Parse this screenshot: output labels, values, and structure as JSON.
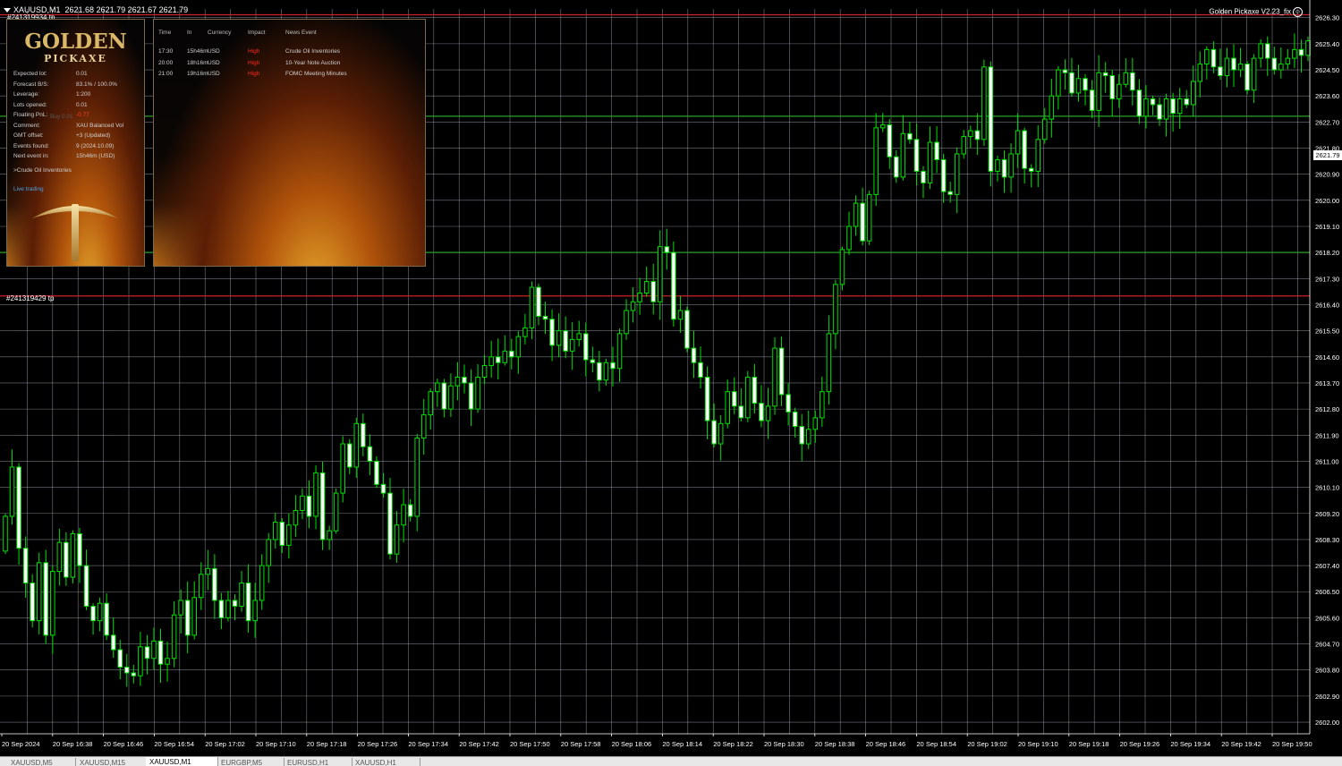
{
  "window": {
    "symbol_info": "XAUUSD,M1",
    "ohlc": "2621.68 2621.79 2621.67 2621.79",
    "ea_label": "Golden Pickaxe V2.23_fix",
    "current_price": "2621.79"
  },
  "trade_labels": {
    "top": "#241319934 tp",
    "middle": "#241319429 tp"
  },
  "panel": {
    "logo_top": "GOLDEN",
    "logo_bottom": "PICKAXE",
    "rows": [
      {
        "key": "Expected lot:",
        "value": "0.01"
      },
      {
        "key": "Forecast B/S:",
        "value": "83.1% / 100.0%"
      },
      {
        "key": "Leverage:",
        "value": "1:200"
      },
      {
        "key": "Lots opened:",
        "value": "0.01"
      },
      {
        "key": "Floating PnL:",
        "value": "-0.77"
      },
      {
        "key": "Comment:",
        "value": "XAU Balanced Vol"
      },
      {
        "key": "GMT offset:",
        "value": "+3 (Updated)"
      },
      {
        "key": "Events found:",
        "value": "9 (2024.10.09)"
      },
      {
        "key": "Next event in:",
        "value": "15h46m (USD)"
      }
    ],
    "buy_ghost": "Buy 0.01",
    "next_news": ">Crude Oil Inventories",
    "live_trading": "Live trading"
  },
  "news": {
    "headers": [
      "Time",
      "In",
      "Currency",
      "Impact",
      "News Event"
    ],
    "rows": [
      {
        "time": "17:30",
        "in": "15h46m",
        "currency": "USD",
        "impact": "High",
        "event": "Crude Oil Inventories"
      },
      {
        "time": "20:00",
        "in": "18h16m",
        "currency": "USD",
        "impact": "High",
        "event": "10-Year Note Auction"
      },
      {
        "time": "21:00",
        "in": "19h16m",
        "currency": "USD",
        "impact": "High",
        "event": "FOMC Meeting Minutes"
      }
    ]
  },
  "tabs": [
    {
      "label": "XAUUSD,M5",
      "active": false
    },
    {
      "label": "XAUUSD,M15",
      "active": false
    },
    {
      "label": "XAUUSD,M1",
      "active": true
    },
    {
      "label": "EURGBP,M5",
      "active": false
    },
    {
      "label": "EURUSD,H1",
      "active": false
    },
    {
      "label": "XAUUSD,H1",
      "active": false
    }
  ],
  "chart_data": {
    "type": "candlestick",
    "symbol": "XAUUSD",
    "timeframe": "M1",
    "ylim": [
      2601.6,
      2626.6
    ],
    "y_ticks": [
      "2626.30",
      "2625.40",
      "2624.50",
      "2623.60",
      "2622.70",
      "2621.80",
      "2620.90",
      "2620.00",
      "2619.10",
      "2618.20",
      "2617.30",
      "2616.40",
      "2615.50",
      "2614.60",
      "2613.70",
      "2612.80",
      "2611.90",
      "2611.00",
      "2610.10",
      "2609.20",
      "2608.30",
      "2607.40",
      "2606.50",
      "2605.60",
      "2604.70",
      "2603.80",
      "2602.90",
      "2602.00"
    ],
    "x_ticks": [
      "20 Sep 2024",
      "20 Sep 16:38",
      "20 Sep 16:46",
      "20 Sep 16:54",
      "20 Sep 17:02",
      "20 Sep 17:10",
      "20 Sep 17:18",
      "20 Sep 17:26",
      "20 Sep 17:34",
      "20 Sep 17:42",
      "20 Sep 17:50",
      "20 Sep 17:58",
      "20 Sep 18:06",
      "20 Sep 18:14",
      "20 Sep 18:22",
      "20 Sep 18:30",
      "20 Sep 18:38",
      "20 Sep 18:46",
      "20 Sep 18:54",
      "20 Sep 19:02",
      "20 Sep 19:10",
      "20 Sep 19:18",
      "20 Sep 19:26",
      "20 Sep 19:34",
      "20 Sep 19:42",
      "20 Sep 19:50"
    ],
    "levels": [
      {
        "price": 2626.4,
        "color": "#d0202a"
      },
      {
        "price": 2622.9,
        "color": "#2aa02a"
      },
      {
        "price": 2618.2,
        "color": "#2aa02a"
      },
      {
        "price": 2616.7,
        "color": "#d0202a"
      }
    ],
    "colors": {
      "bull": "#000000",
      "bear": "#ffffff",
      "outline": "#00e000",
      "grid": "#cfd8e8"
    },
    "closes": [
      2609.1,
      2610.8,
      2608.0,
      2606.8,
      2605.5,
      2607.5,
      2605.0,
      2607.2,
      2608.2,
      2607.0,
      2608.5,
      2607.4,
      2606.0,
      2605.5,
      2606.1,
      2605.0,
      2604.5,
      2603.9,
      2603.7,
      2603.6,
      2604.6,
      2604.2,
      2604.8,
      2604.0,
      2604.2,
      2605.7,
      2606.2,
      2605.0,
      2606.3,
      2607.1,
      2607.3,
      2606.2,
      2605.6,
      2606.2,
      2606.0,
      2606.8,
      2605.5,
      2606.2,
      2607.4,
      2608.3,
      2608.9,
      2608.1,
      2608.8,
      2609.3,
      2609.8,
      2609.1,
      2610.6,
      2608.3,
      2608.6,
      2609.9,
      2611.6,
      2610.8,
      2612.3,
      2611.5,
      2611.0,
      2610.2,
      2609.9,
      2607.8,
      2608.8,
      2609.5,
      2609.1,
      2611.8,
      2612.6,
      2613.4,
      2613.7,
      2612.8,
      2613.6,
      2613.9,
      2613.7,
      2612.8,
      2613.9,
      2614.3,
      2614.6,
      2614.4,
      2614.8,
      2614.6,
      2615.3,
      2615.6,
      2617.0,
      2616.0,
      2615.9,
      2615.0,
      2615.5,
      2614.8,
      2615.2,
      2615.4,
      2614.5,
      2614.4,
      2613.8,
      2614.4,
      2614.2,
      2615.4,
      2616.2,
      2616.5,
      2616.8,
      2617.2,
      2616.5,
      2618.4,
      2618.2,
      2615.9,
      2616.2,
      2614.9,
      2614.4,
      2613.9,
      2612.4,
      2611.6,
      2612.3,
      2613.4,
      2612.9,
      2612.5,
      2613.9,
      2613.0,
      2612.4,
      2612.9,
      2614.9,
      2613.3,
      2612.7,
      2612.2,
      2611.6,
      2612.1,
      2612.5,
      2613.4,
      2615.4,
      2617.1,
      2618.3,
      2619.1,
      2619.9,
      2618.6,
      2620.2,
      2622.5,
      2622.6,
      2621.5,
      2620.8,
      2622.3,
      2622.1,
      2621.0,
      2620.6,
      2622.0,
      2621.4,
      2620.3,
      2620.2,
      2621.6,
      2622.2,
      2622.4,
      2622.1,
      2624.6,
      2621.0,
      2621.4,
      2620.8,
      2621.6,
      2622.4,
      2621.1,
      2621.0,
      2622.1,
      2622.8,
      2623.6,
      2624.5,
      2624.4,
      2623.7,
      2624.2,
      2623.8,
      2623.1,
      2624.4,
      2624.3,
      2623.5,
      2624.0,
      2624.4,
      2623.8,
      2622.9,
      2623.5,
      2623.3,
      2622.8,
      2623.5,
      2623.0,
      2623.5,
      2623.3,
      2624.1,
      2624.7,
      2625.2,
      2624.6,
      2624.3,
      2624.9,
      2624.5,
      2624.7,
      2623.8,
      2624.9,
      2625.4,
      2624.9,
      2624.5,
      2624.7,
      2624.9,
      2625.2,
      2625.0,
      2625.5
    ]
  }
}
